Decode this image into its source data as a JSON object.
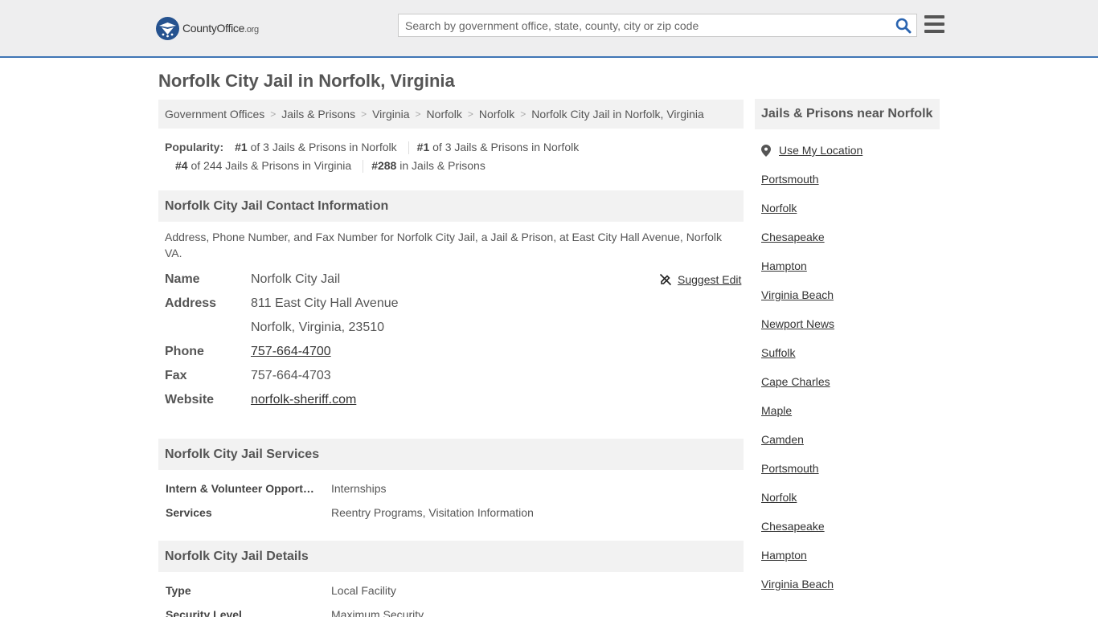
{
  "header": {
    "logo_main": "CountyOffice",
    "logo_ext": ".org",
    "search_placeholder": "Search by government office, state, county, city or zip code"
  },
  "page_title": "Norfolk City Jail in Norfolk, Virginia",
  "breadcrumb": [
    "Government Offices",
    "Jails & Prisons",
    "Virginia",
    "Norfolk",
    "Norfolk",
    "Norfolk City Jail in Norfolk, Virginia"
  ],
  "popularity": {
    "label": "Popularity:",
    "items": [
      {
        "rank": "#1",
        "text": "of 3 Jails & Prisons in Norfolk"
      },
      {
        "rank": "#1",
        "text": "of 3 Jails & Prisons in Norfolk"
      },
      {
        "rank": "#4",
        "text": "of 244 Jails & Prisons in Virginia"
      },
      {
        "rank": "#288",
        "text": "in Jails & Prisons"
      }
    ]
  },
  "contact": {
    "heading": "Norfolk City Jail Contact Information",
    "description": "Address, Phone Number, and Fax Number for Norfolk City Jail, a Jail & Prison, at East City Hall Avenue, Norfolk VA.",
    "suggest_edit": "Suggest Edit",
    "name_label": "Name",
    "name": "Norfolk City Jail",
    "address_label": "Address",
    "address_line1": "811 East City Hall Avenue",
    "address_line2": "Norfolk, Virginia, 23510",
    "phone_label": "Phone",
    "phone": "757-664-4700",
    "fax_label": "Fax",
    "fax": "757-664-4703",
    "website_label": "Website",
    "website": "norfolk-sheriff.com"
  },
  "services": {
    "heading": "Norfolk City Jail Services",
    "rows": [
      {
        "key": "Intern & Volunteer Opportunities",
        "value": "Internships"
      },
      {
        "key": "Services",
        "value": "Reentry Programs, Visitation Information"
      }
    ]
  },
  "details": {
    "heading": "Norfolk City Jail Details",
    "rows": [
      {
        "key": "Type",
        "value": "Local Facility"
      },
      {
        "key": "Security Level",
        "value": "Maximum Security"
      }
    ]
  },
  "sidebar": {
    "heading": "Jails & Prisons near Norfolk",
    "use_location": "Use My Location",
    "items": [
      "Portsmouth",
      "Norfolk",
      "Chesapeake",
      "Hampton",
      "Virginia Beach",
      "Newport News",
      "Suffolk",
      "Cape Charles",
      "Maple",
      "Camden",
      "Portsmouth",
      "Norfolk",
      "Chesapeake",
      "Hampton",
      "Virginia Beach"
    ]
  },
  "colors": {
    "header_bg": "#eeeeef",
    "header_border": "#3f75b5",
    "logo_blue": "#25528f",
    "search_icon": "#2a64b0"
  }
}
